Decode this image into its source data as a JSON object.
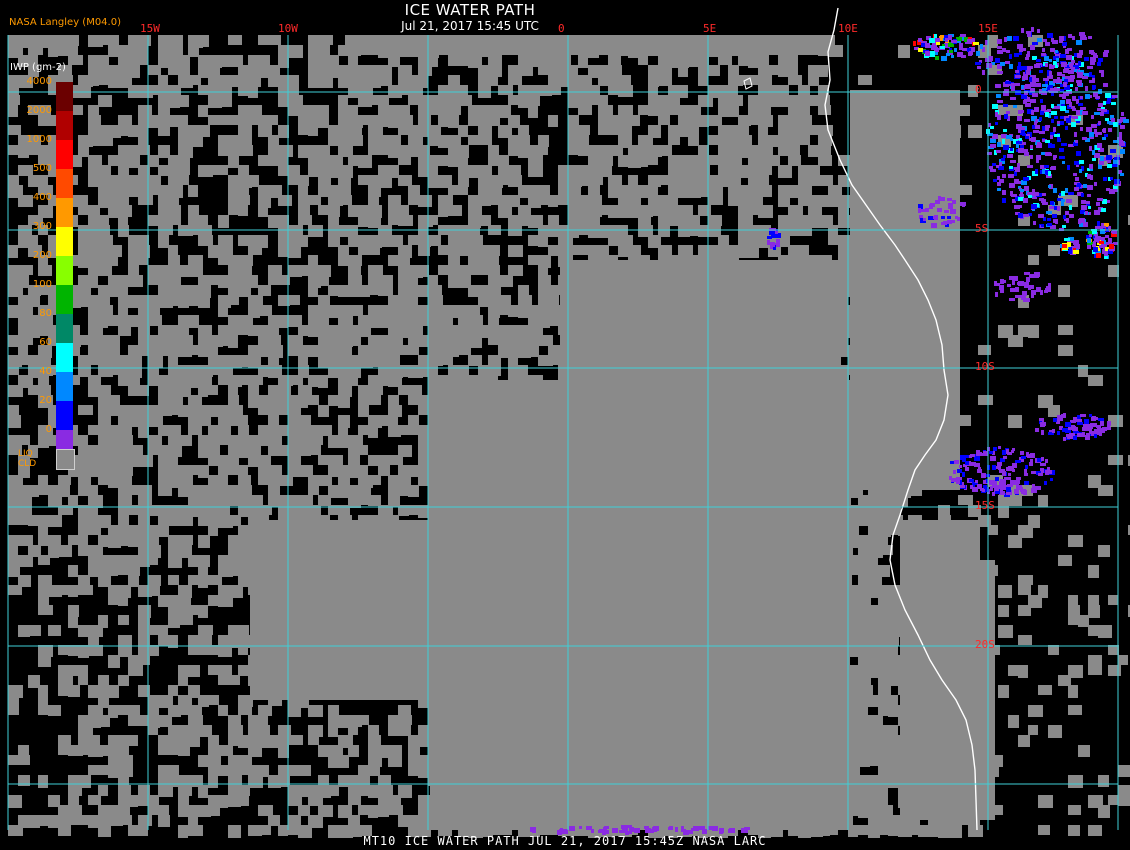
{
  "header": {
    "title": "ICE WATER PATH",
    "datetime": "Jul 21, 2017 15:45 UTC",
    "brand": "NASA Langley (M04.0)"
  },
  "footer": {
    "caption": "MT10  ICE WATER PATH  JUL 21, 2017 15:45Z  NASA LARC"
  },
  "colorbar": {
    "units": "IWP (gm-2)",
    "labels": [
      "4000",
      "2000",
      "1000",
      "500",
      "400",
      "300",
      "200",
      "100",
      "80",
      "60",
      "40",
      "20",
      "0"
    ],
    "colors": [
      "#6b0000",
      "#b00000",
      "#ff0000",
      "#ff4a00",
      "#ff9900",
      "#ffff00",
      "#88ff00",
      "#00b400",
      "#008866",
      "#00ffff",
      "#0088ff",
      "#0000ff",
      "#8a2be2"
    ],
    "liq_label_line1": "LIQ",
    "liq_label_line2": "CLD",
    "liq_color": "#8a8a8a"
  },
  "grid": {
    "color": "#3fd0d8",
    "lon_labels": [
      "15W",
      "10W",
      "0",
      "5E",
      "10E",
      "15E"
    ],
    "lat_labels": [
      "0",
      "5S",
      "10S",
      "15S",
      "20S"
    ]
  },
  "colors": {
    "background": "#000000",
    "liquid_cloud": "#8a8a8a",
    "coastline": "#ffffff",
    "label_red": "#ff2a2a",
    "label_orange": "#ff9a00"
  }
}
